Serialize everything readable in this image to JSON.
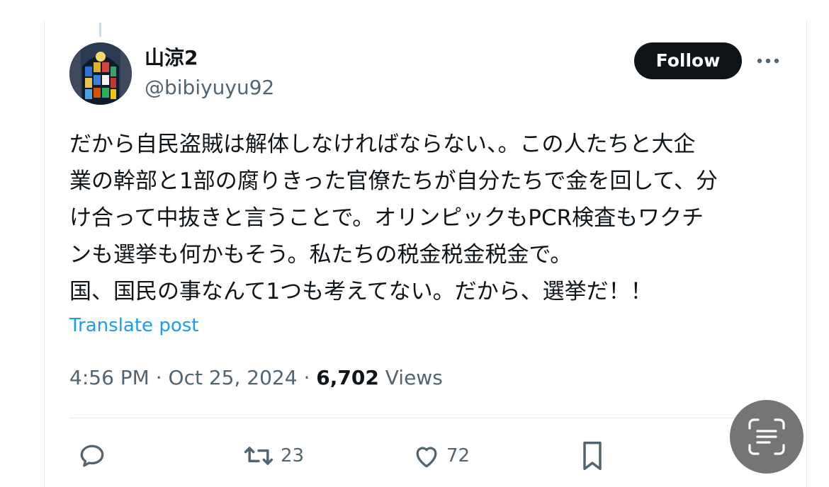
{
  "tweet": {
    "author_name": "山涼2",
    "author_handle": "@bibiyuyu92",
    "follow_label": "Follow",
    "text_lines": [
      "だから自民盗賊は解体しなければならない、。この人たちと大企",
      "業の幹部と1部の腐りきった官僚たちが自分たちで金を回して、分",
      "け合って中抜きと言うことで。オリンピックもPCR検査もワクチ",
      "ンも選挙も何かもそう。私たちの税金税金税金で。",
      "国、国民の事なんて1つも考えてない。だから、選挙だ！！"
    ],
    "translate_label": "Translate post",
    "time": "4:56 PM",
    "date": "Oct 25, 2024",
    "views_count": "6,702",
    "views_label": "Views",
    "separator": "·"
  },
  "actions": {
    "reply_icon": "reply-icon",
    "repost_icon": "repost-icon",
    "repost_count": "23",
    "like_icon": "heart-icon",
    "like_count": "72",
    "bookmark_icon": "bookmark-icon"
  },
  "overlay": {
    "lens_icon": "live-text-scan-icon"
  },
  "colors": {
    "accent": "#1d9bf0",
    "secondary_text": "#536471",
    "primary_text": "#0f1419",
    "follow_bg": "#0f1419"
  }
}
